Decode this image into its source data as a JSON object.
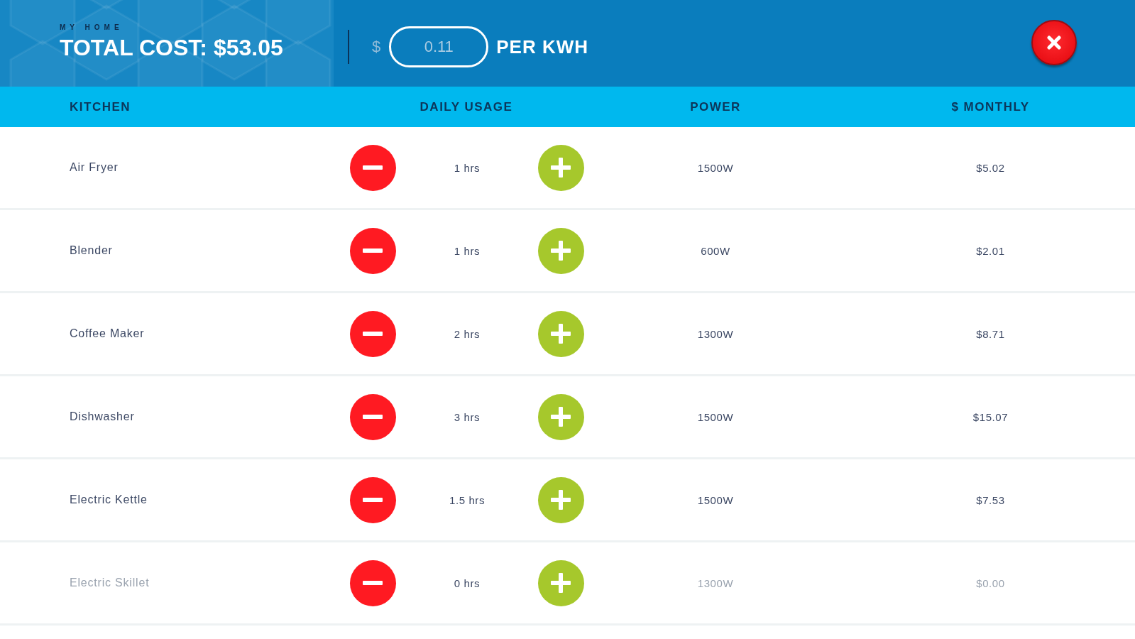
{
  "header": {
    "subtitle": "MY HOME",
    "title": "TOTAL COST: $53.05",
    "rate": {
      "prefix": "$",
      "value": "0.11",
      "suffix": "PER KWH"
    }
  },
  "table": {
    "columns": [
      "KITCHEN",
      "DAILY USAGE",
      "POWER",
      "$ MONTHLY"
    ],
    "rows": [
      {
        "name": "Air Fryer",
        "hours": "1 hrs",
        "power": "1500W",
        "monthly": "$5.02",
        "active": true
      },
      {
        "name": "Blender",
        "hours": "1 hrs",
        "power": "600W",
        "monthly": "$2.01",
        "active": true
      },
      {
        "name": "Coffee Maker",
        "hours": "2 hrs",
        "power": "1300W",
        "monthly": "$8.71",
        "active": true
      },
      {
        "name": "Dishwasher",
        "hours": "3 hrs",
        "power": "1500W",
        "monthly": "$15.07",
        "active": true
      },
      {
        "name": "Electric Kettle",
        "hours": "1.5 hrs",
        "power": "1500W",
        "monthly": "$7.53",
        "active": true
      },
      {
        "name": "Electric Skillet",
        "hours": "0 hrs",
        "power": "1300W",
        "monthly": "$0.00",
        "active": false
      }
    ]
  }
}
